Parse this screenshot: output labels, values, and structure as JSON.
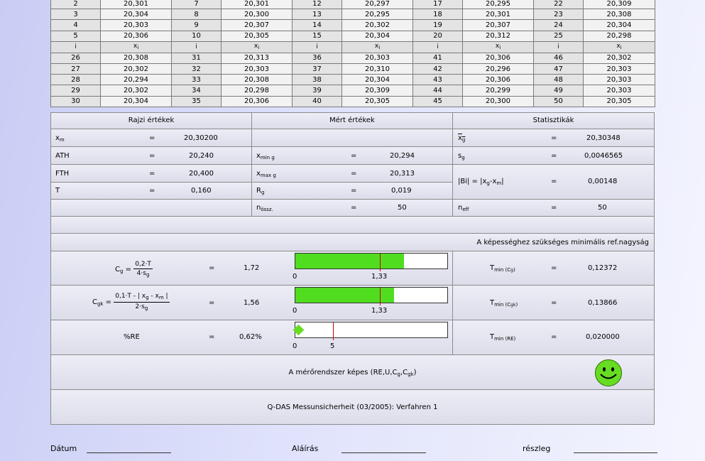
{
  "values_table": {
    "header": [
      "i",
      "xi",
      "i",
      "xi",
      "i",
      "xi",
      "i",
      "xi",
      "i",
      "xi"
    ],
    "rows_top": [
      [
        "2",
        "20,301",
        "7",
        "20,301",
        "12",
        "20,297",
        "17",
        "20,295",
        "22",
        "20,309"
      ],
      [
        "3",
        "20,304",
        "8",
        "20,300",
        "13",
        "20,295",
        "18",
        "20,301",
        "23",
        "20,308"
      ],
      [
        "4",
        "20,303",
        "9",
        "20,307",
        "14",
        "20,302",
        "19",
        "20,307",
        "24",
        "20,304"
      ],
      [
        "5",
        "20,306",
        "10",
        "20,305",
        "15",
        "20,304",
        "20",
        "20,312",
        "25",
        "20,298"
      ]
    ],
    "rows_bottom": [
      [
        "26",
        "20,308",
        "31",
        "20,313",
        "36",
        "20,303",
        "41",
        "20,306",
        "46",
        "20,302"
      ],
      [
        "27",
        "20,302",
        "32",
        "20,303",
        "37",
        "20,310",
        "42",
        "20,296",
        "47",
        "20,303"
      ],
      [
        "28",
        "20,294",
        "33",
        "20,308",
        "38",
        "20,304",
        "43",
        "20,306",
        "48",
        "20,303"
      ],
      [
        "29",
        "20,302",
        "34",
        "20,298",
        "39",
        "20,309",
        "44",
        "20,299",
        "49",
        "20,303"
      ],
      [
        "30",
        "20,304",
        "35",
        "20,306",
        "40",
        "20,305",
        "45",
        "20,300",
        "50",
        "20,305"
      ]
    ]
  },
  "sections": {
    "rajzi": "Rajzi értékek",
    "mert": "Mért értékek",
    "stat": "Statisztikák"
  },
  "rajzi": {
    "xm_label": "x",
    "xm_sub": "m",
    "xm_value": "20,30200",
    "ath_label": "ATH",
    "ath_value": "20,240",
    "fth_label": "FTH",
    "fth_value": "20,400",
    "t_label": "T",
    "t_value": "0,160"
  },
  "mert": {
    "xmin_label": "x",
    "xmin_sub": "min g",
    "xmin_value": "20,294",
    "xmax_label": "x",
    "xmax_sub": "max g",
    "xmax_value": "20,313",
    "rg_label": "R",
    "rg_sub": "g",
    "rg_value": "0,019",
    "n_label": "n",
    "n_sub": "össz.",
    "n_value": "50"
  },
  "stat": {
    "xg_label": "x",
    "xg_sub": "g",
    "xg_value": "20,30348",
    "sg_label": "s",
    "sg_sub": "g",
    "sg_value": "0,0046565",
    "bi_label": "|Bi| = |x",
    "bi_label_mid": "g",
    "bi_label_tail": "-x",
    "bi_label_sub2": "m",
    "bi_label_end": "|",
    "bi_value": "0,00148",
    "neff_label": "n",
    "neff_sub": "eff",
    "neff_value": "50"
  },
  "eq": "=",
  "min_ref_title": "A képességhez szükséges minimális ref.nagyság",
  "cg": {
    "label": "C",
    "label_sub": "g",
    "num": "0,2·T",
    "den": "4·s",
    "den_sub": "g",
    "value": "1,72",
    "bar_value": 1.72,
    "bar_max": 2.4,
    "tick0": "0",
    "tick_limit": "1,33",
    "limit": 1.33,
    "tmin_label": "T",
    "tmin_sub": "min (C",
    "tmin_sub2": "g",
    "tmin_sub3": ")",
    "tmin_value": "0,12372"
  },
  "cgk": {
    "label": "C",
    "label_sub": "gk",
    "num": "0,1·T - | x",
    "num_sub": "g",
    "num_tail": " - x",
    "num_sub2": "m",
    "num_end": " |",
    "den": "2·s",
    "den_sub": "g",
    "value": "1,56",
    "bar_value": 1.56,
    "bar_max": 2.4,
    "tick0": "0",
    "tick_limit": "1,33",
    "limit": 1.33,
    "tmin_label": "T",
    "tmin_sub": "min (C",
    "tmin_sub2": "gk",
    "tmin_sub3": ")",
    "tmin_value": "0,13866"
  },
  "re": {
    "label": "%RE",
    "value": "0,62%",
    "tick0": "0",
    "tick_limit": "5",
    "tmin_label": "T",
    "tmin_sub": "min (RE)",
    "tmin_value": "0,020000"
  },
  "capable_text": "A mérőrendszer képes (RE,U,C",
  "capable_sub1": "g",
  "capable_mid": ",C",
  "capable_sub2": "gk",
  "capable_end": ")",
  "footer_text": "Q-DAS Messunsicherheit (03/2005): Verfahren 1",
  "sign": {
    "datum": "Dátum",
    "alairas": "Aláírás",
    "reszleg": "részleg"
  },
  "colors": {
    "bar_fill": "#50dd20",
    "limit_line": "#cc0000",
    "smiley": "#66dd22"
  },
  "icons": {
    "smiley": "smiley-face-icon",
    "indicator": "diamond-icon"
  }
}
